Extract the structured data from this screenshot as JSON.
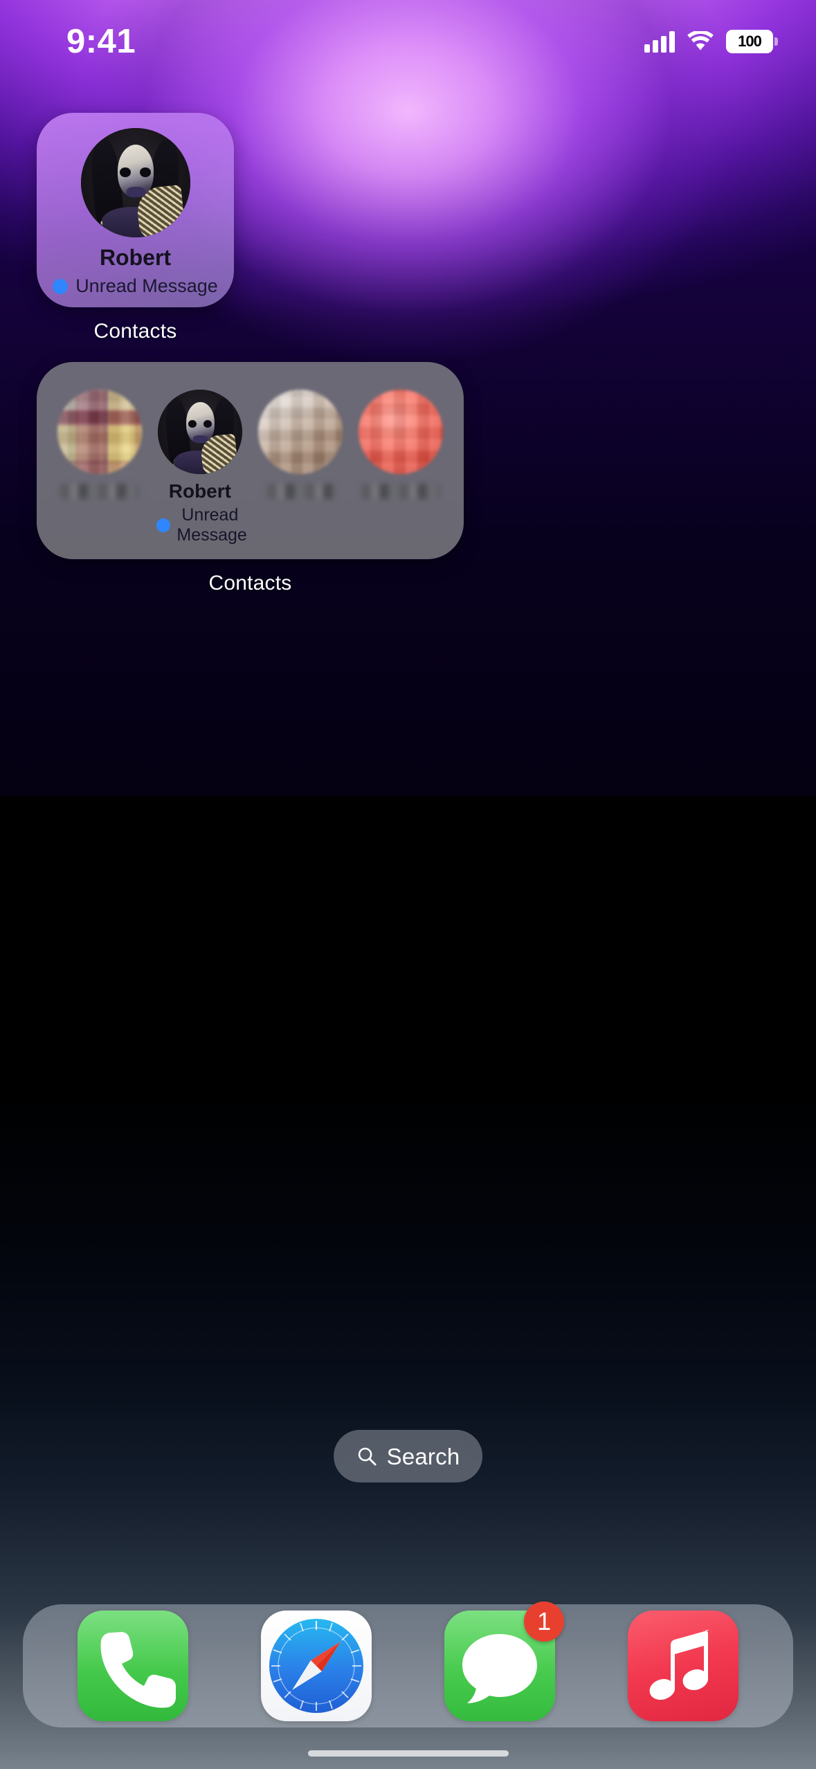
{
  "status_bar": {
    "time": "9:41",
    "signal_icon": "cellular-signal-icon",
    "wifi_icon": "wifi-icon",
    "battery_icon": "battery-icon",
    "battery_level": "100"
  },
  "widgets": [
    {
      "id": "contacts-small",
      "label": "Contacts",
      "size": "small",
      "contacts": [
        {
          "name": "Robert",
          "status": "Unread Message",
          "status_dot_color": "#2f86ff",
          "avatar": "robert-portrait-avatar",
          "redacted": false
        }
      ]
    },
    {
      "id": "contacts-medium",
      "label": "Contacts",
      "size": "medium",
      "contacts": [
        {
          "name": "",
          "status": "",
          "avatar": "pixelated-avatar-1",
          "redacted": true
        },
        {
          "name": "Robert",
          "status_line_1": "Unread",
          "status_line_2": "Message",
          "status": "Unread Message",
          "status_dot_color": "#2f86ff",
          "avatar": "robert-portrait-avatar",
          "redacted": false
        },
        {
          "name": "",
          "status": "",
          "avatar": "pixelated-avatar-3",
          "redacted": true
        },
        {
          "name": "",
          "status": "",
          "avatar": "pixelated-avatar-4",
          "redacted": true
        }
      ]
    }
  ],
  "search": {
    "label": "Search",
    "icon": "search-icon"
  },
  "dock": {
    "apps": [
      {
        "name": "Phone",
        "icon": "phone-icon",
        "color": "#45c94c",
        "badge": null
      },
      {
        "name": "Safari",
        "icon": "compass-icon",
        "color": "#1d7ff0",
        "badge": null
      },
      {
        "name": "Messages",
        "icon": "message-bubble-icon",
        "color": "#48cb4e",
        "badge": "1"
      },
      {
        "name": "Music",
        "icon": "music-note-icon",
        "color": "#f2394f",
        "badge": null
      }
    ],
    "badge_color": "#e8402f"
  },
  "theme": {
    "wallpaper_top": "#d98ef0",
    "wallpaper_mid": "#000000",
    "wallpaper_bottom": "#7a848e",
    "accent_blue": "#2f86ff"
  }
}
